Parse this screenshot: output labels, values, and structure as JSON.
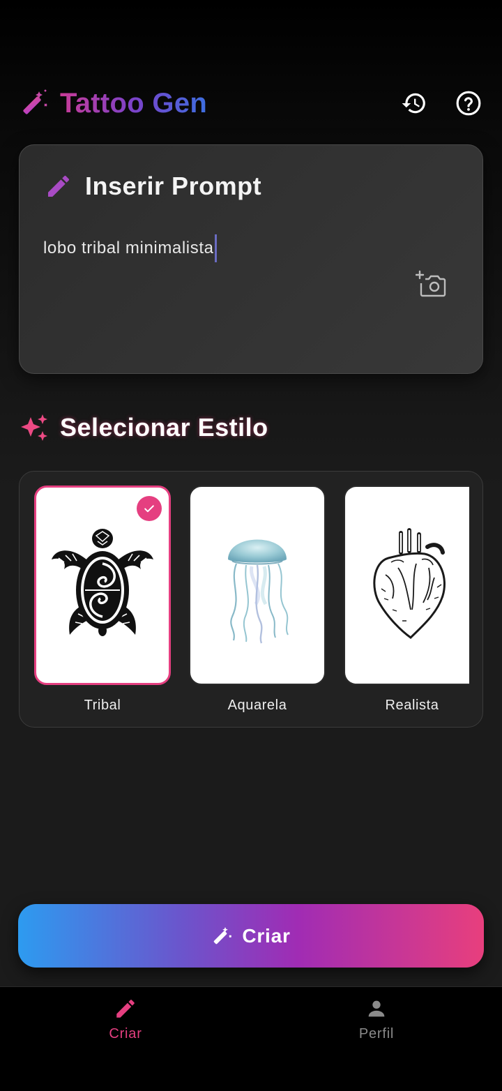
{
  "app": {
    "title": "Tattoo Gen"
  },
  "header": {
    "history_icon": "history-icon",
    "help_icon": "help-icon"
  },
  "prompt": {
    "title": "Inserir Prompt",
    "value": "lobo tribal minimalista",
    "camera_icon": "add-photo-icon"
  },
  "styles": {
    "title": "Selecionar Estilo",
    "items": [
      {
        "label": "Tribal",
        "selected": true,
        "image": "tribal-turtle"
      },
      {
        "label": "Aquarela",
        "selected": false,
        "image": "watercolor-jellyfish"
      },
      {
        "label": "Realista",
        "selected": false,
        "image": "realistic-heart"
      }
    ]
  },
  "action": {
    "create_label": "Criar"
  },
  "nav": {
    "items": [
      {
        "label": "Criar",
        "icon": "pencil-icon",
        "active": true
      },
      {
        "label": "Perfil",
        "icon": "person-icon",
        "active": false
      }
    ]
  },
  "colors": {
    "accent": "#e53f80",
    "brand_purple": "#a84bc4",
    "background": "#1b1b1b"
  }
}
